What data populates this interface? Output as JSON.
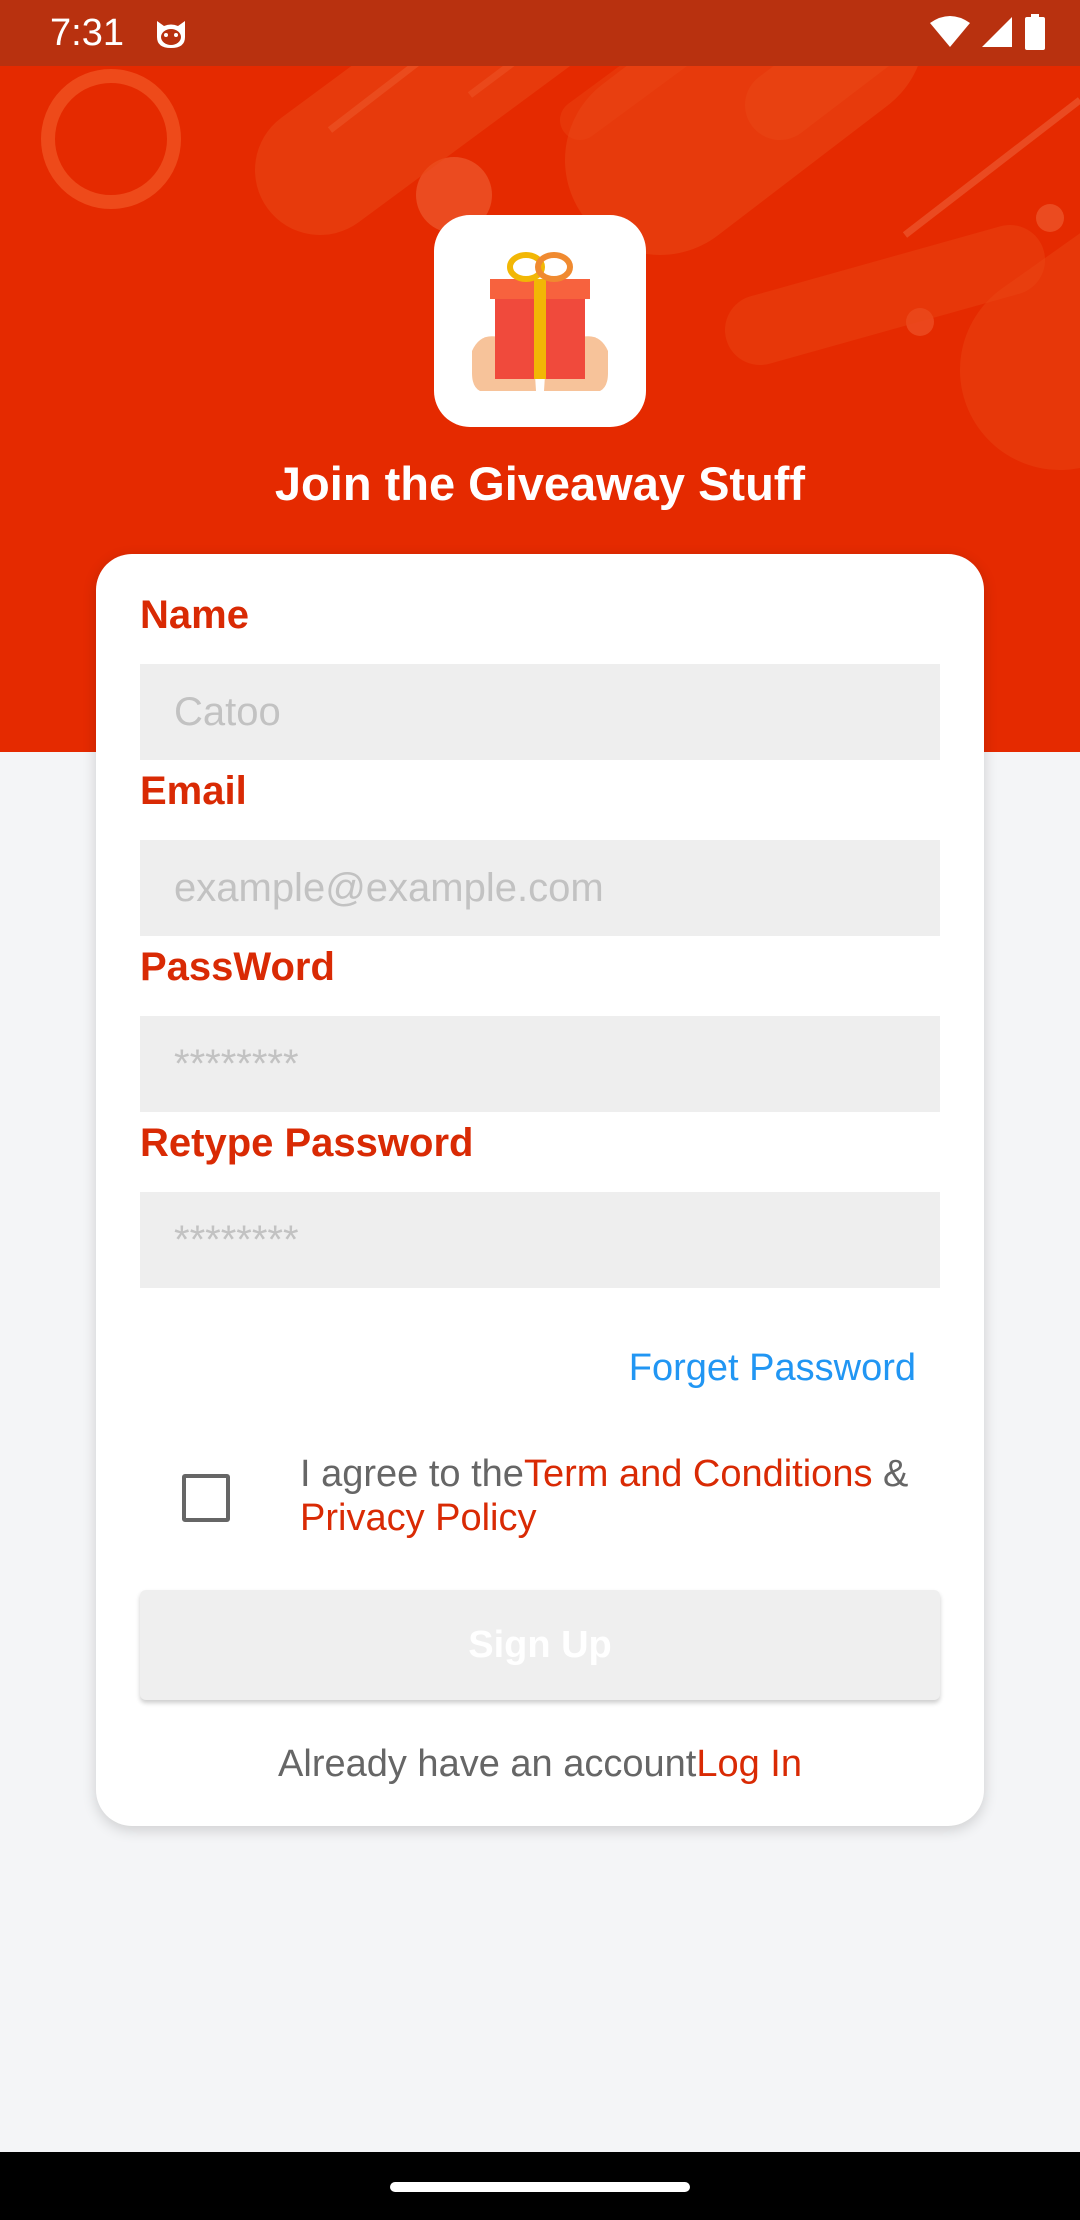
{
  "status_bar": {
    "time": "7:31",
    "app_icon": "cat-face-icon",
    "icons": [
      "wifi-icon",
      "signal-icon",
      "battery-icon"
    ]
  },
  "header": {
    "logo_icon": "gift-in-hands-icon",
    "title": "Join the  Giveaway Stuff"
  },
  "form": {
    "name_label": "Name",
    "name_placeholder": "Catoo",
    "email_label": "Email",
    "email_placeholder": "example@example.com",
    "password_label": "PassWord",
    "password_placeholder": "********",
    "retype_label": "Retype Password",
    "retype_placeholder": "********",
    "forget_password": "Forget Password",
    "agree_prefix": "I agree to the",
    "terms_link": "Term and Conditions",
    "agree_and": " & ",
    "privacy_link": "Privacy Policy",
    "signup_label": "Sign Up",
    "login_prompt": "Already have an account",
    "login_link": "Log In"
  },
  "colors": {
    "brand_red": "#e52a00",
    "label_red": "#d92a04",
    "link_blue": "#2196f3"
  }
}
